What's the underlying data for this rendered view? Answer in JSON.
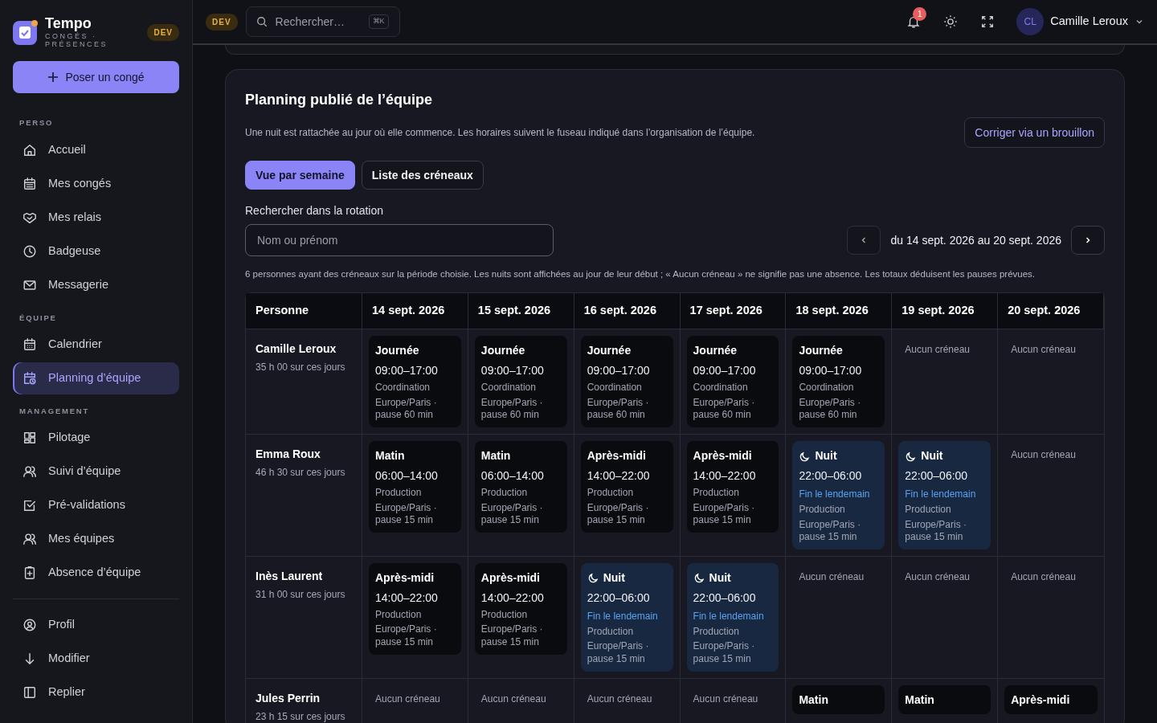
{
  "brand": {
    "name": "Tempo",
    "subtitle": "CONGÉS · PRÉSENCES",
    "env_badge": "DEV"
  },
  "primary_action": "Poser un congé",
  "sidebar": {
    "sections": [
      {
        "title": "PERSO",
        "items": [
          {
            "label": "Accueil",
            "selected": false
          },
          {
            "label": "Mes congés",
            "selected": false
          },
          {
            "label": "Mes relais",
            "selected": false
          },
          {
            "label": "Badgeuse",
            "selected": false
          },
          {
            "label": "Messagerie",
            "selected": false
          }
        ]
      },
      {
        "title": "ÉQUIPE",
        "items": [
          {
            "label": "Calendrier",
            "selected": false
          },
          {
            "label": "Planning d’équipe",
            "selected": true
          }
        ]
      },
      {
        "title": "MANAGEMENT",
        "items": [
          {
            "label": "Pilotage",
            "selected": false
          },
          {
            "label": "Suivi d’équipe",
            "selected": false
          },
          {
            "label": "Pré-validations",
            "selected": false
          },
          {
            "label": "Mes équipes",
            "selected": false
          },
          {
            "label": "Absence d’équipe",
            "selected": false
          }
        ]
      }
    ],
    "footer_items": [
      "Profil",
      "Modifier",
      "Replier"
    ]
  },
  "topbar": {
    "env_badge": "DEV",
    "search": {
      "placeholder": "Rechercher…",
      "shortcut": "⌘K"
    },
    "notifications": "1",
    "user": {
      "initials": "CL",
      "name": "Camille Leroux"
    }
  },
  "panel": {
    "title": "Planning publié de l’équipe",
    "note": "Une nuit est rattachée au jour où elle commence. Les horaires suivent le fuseau indiqué dans l’organisation de l’équipe.",
    "action": "Corriger via un brouillon",
    "views": [
      {
        "label": "Vue par semaine",
        "selected": true
      },
      {
        "label": "Liste des créneaux",
        "selected": false
      }
    ],
    "search": {
      "label": "Rechercher dans la rotation",
      "placeholder": "Nom ou prénom"
    },
    "range": "du 14 sept. 2026 au 20 sept. 2026",
    "summary": "6 personnes ayant des créneaux sur la période choisie. Les nuits sont affichées au jour de leur début ; « Aucun créneau » ne signifie pas une absence. Les totaux déduisent les pauses prévues.",
    "columns": [
      "Personne",
      "14 sept. 2026",
      "15 sept. 2026",
      "16 sept. 2026",
      "17 sept. 2026",
      "18 sept. 2026",
      "19 sept. 2026",
      "20 sept. 2026"
    ],
    "rows": [
      {
        "cells": [
          {
            "kind": "person",
            "name": "Camille Leroux",
            "total": "35 h 00 sur ces jours"
          },
          {
            "kind": "day",
            "title": "Journée",
            "time": "09:00–17:00",
            "team": "Coordination",
            "details": "Europe/Paris · pause 60 min"
          },
          {
            "kind": "day",
            "title": "Journée",
            "time": "09:00–17:00",
            "team": "Coordination",
            "details": "Europe/Paris · pause 60 min"
          },
          {
            "kind": "day",
            "title": "Journée",
            "time": "09:00–17:00",
            "team": "Coordination",
            "details": "Europe/Paris · pause 60 min"
          },
          {
            "kind": "day",
            "title": "Journée",
            "time": "09:00–17:00",
            "team": "Coordination",
            "details": "Europe/Paris · pause 60 min"
          },
          {
            "kind": "day",
            "title": "Journée",
            "time": "09:00–17:00",
            "team": "Coordination",
            "details": "Europe/Paris · pause 60 min"
          },
          {
            "kind": "empty",
            "text": "Aucun créneau"
          },
          {
            "kind": "empty",
            "text": "Aucun créneau"
          }
        ]
      },
      {
        "cells": [
          {
            "kind": "person",
            "name": "Emma Roux",
            "total": "46 h 30 sur ces jours"
          },
          {
            "kind": "day",
            "title": "Matin",
            "time": "06:00–14:00",
            "team": "Production",
            "details": "Europe/Paris · pause 15 min"
          },
          {
            "kind": "day",
            "title": "Matin",
            "time": "06:00–14:00",
            "team": "Production",
            "details": "Europe/Paris · pause 15 min"
          },
          {
            "kind": "day",
            "title": "Après-midi",
            "time": "14:00–22:00",
            "team": "Production",
            "details": "Europe/Paris · pause 15 min"
          },
          {
            "kind": "day",
            "title": "Après-midi",
            "time": "14:00–22:00",
            "team": "Production",
            "details": "Europe/Paris · pause 15 min"
          },
          {
            "kind": "night",
            "title": "Nuit",
            "time": "22:00–06:00",
            "next_day": "Fin le lendemain",
            "team": "Production",
            "details": "Europe/Paris · pause 15 min"
          },
          {
            "kind": "night",
            "title": "Nuit",
            "time": "22:00–06:00",
            "next_day": "Fin le lendemain",
            "team": "Production",
            "details": "Europe/Paris · pause 15 min"
          },
          {
            "kind": "empty",
            "text": "Aucun créneau"
          }
        ]
      },
      {
        "cells": [
          {
            "kind": "person",
            "name": "Inès Laurent",
            "total": "31 h 00 sur ces jours"
          },
          {
            "kind": "day",
            "title": "Après-midi",
            "time": "14:00–22:00",
            "team": "Production",
            "details": "Europe/Paris · pause 15 min"
          },
          {
            "kind": "day",
            "title": "Après-midi",
            "time": "14:00–22:00",
            "team": "Production",
            "details": "Europe/Paris · pause 15 min"
          },
          {
            "kind": "night",
            "title": "Nuit",
            "time": "22:00–06:00",
            "next_day": "Fin le lendemain",
            "team": "Production",
            "details": "Europe/Paris · pause 15 min"
          },
          {
            "kind": "night",
            "title": "Nuit",
            "time": "22:00–06:00",
            "next_day": "Fin le lendemain",
            "team": "Production",
            "details": "Europe/Paris · pause 15 min"
          },
          {
            "kind": "empty",
            "text": "Aucun créneau"
          },
          {
            "kind": "empty",
            "text": "Aucun créneau"
          },
          {
            "kind": "empty",
            "text": "Aucun créneau"
          }
        ]
      },
      {
        "cells": [
          {
            "kind": "person",
            "name": "Jules Perrin",
            "total": "23 h 15 sur ces jours"
          },
          {
            "kind": "empty",
            "text": "Aucun créneau"
          },
          {
            "kind": "empty",
            "text": "Aucun créneau"
          },
          {
            "kind": "empty",
            "text": "Aucun créneau"
          },
          {
            "kind": "empty",
            "text": "Aucun créneau"
          },
          {
            "kind": "day",
            "title": "Matin"
          },
          {
            "kind": "day",
            "title": "Matin"
          },
          {
            "kind": "day",
            "title": "Après-midi"
          }
        ]
      }
    ]
  }
}
